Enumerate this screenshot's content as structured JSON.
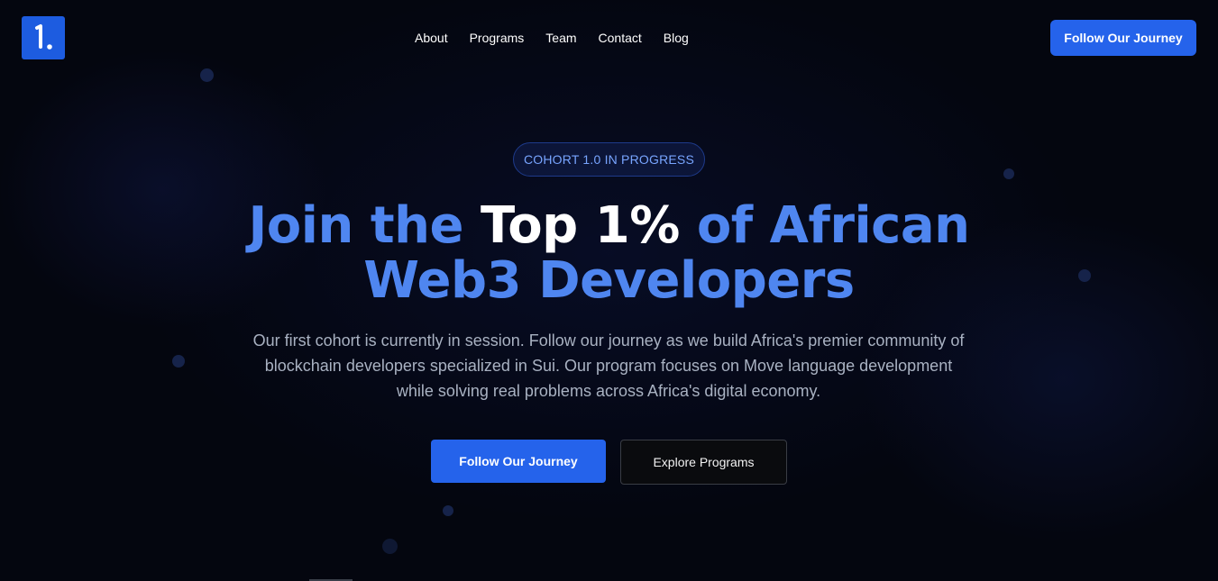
{
  "header": {
    "logo_alt": "1.",
    "nav": [
      "About",
      "Programs",
      "Team",
      "Contact",
      "Blog"
    ],
    "cta_label": "Follow Our Journey"
  },
  "hero": {
    "badge": "COHORT 1.0 IN PROGRESS",
    "headline": {
      "part1": "Join the ",
      "part2": "Top 1%",
      "part3": " of African",
      "line2": "Web3 Developers"
    },
    "subtitle": "Our first cohort is currently in session. Follow our journey as we build Africa's premier community of blockchain developers specialized in Sui. Our program focuses on Move language development while solving real problems across Africa's digital economy.",
    "primary_button": "Follow Our Journey",
    "secondary_button": "Explore Programs"
  },
  "colors": {
    "background": "#04060f",
    "accent": "#2563eb",
    "headline_blue": "#4f86f0",
    "badge_text": "#78a5ff"
  }
}
